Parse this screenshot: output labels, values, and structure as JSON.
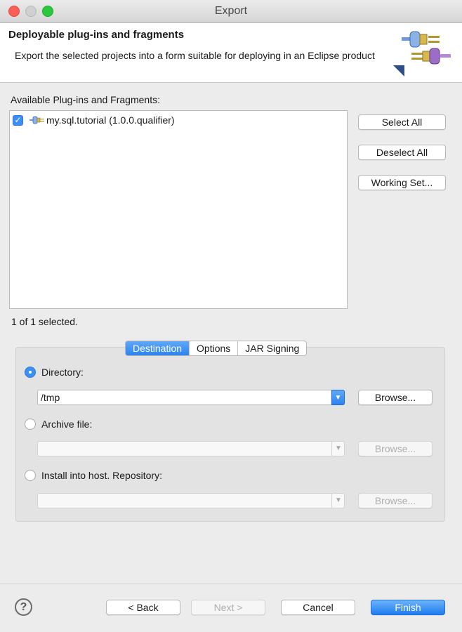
{
  "window": {
    "title": "Export"
  },
  "header": {
    "title": "Deployable plug-ins and fragments",
    "description": "Export the selected projects into a form suitable for deploying in an Eclipse product",
    "icon": "plugin-export-icon"
  },
  "plugins": {
    "label": "Available Plug-ins and Fragments:",
    "items": [
      {
        "label": "my.sql.tutorial (1.0.0.qualifier)",
        "checked": true,
        "icon": "plugin-icon"
      }
    ],
    "selection_status": "1 of 1 selected."
  },
  "side_buttons": {
    "select_all": "Select All",
    "deselect_all": "Deselect All",
    "working_set": "Working Set..."
  },
  "tabs": [
    {
      "label": "Destination",
      "active": true
    },
    {
      "label": "Options",
      "active": false
    },
    {
      "label": "JAR Signing",
      "active": false
    }
  ],
  "destination": {
    "directory_label": "Directory:",
    "directory_value": "/tmp",
    "archive_label": "Archive file:",
    "archive_value": "",
    "install_label": "Install into host. Repository:",
    "install_value": "",
    "browse_label": "Browse...",
    "selected_option": "directory"
  },
  "footer": {
    "back": "< Back",
    "next": "Next >",
    "cancel": "Cancel",
    "finish": "Finish",
    "help_icon": "help-icon"
  },
  "colors": {
    "accent": "#2c83ef",
    "close": "#fc5f57",
    "maximize": "#2bc83f"
  }
}
